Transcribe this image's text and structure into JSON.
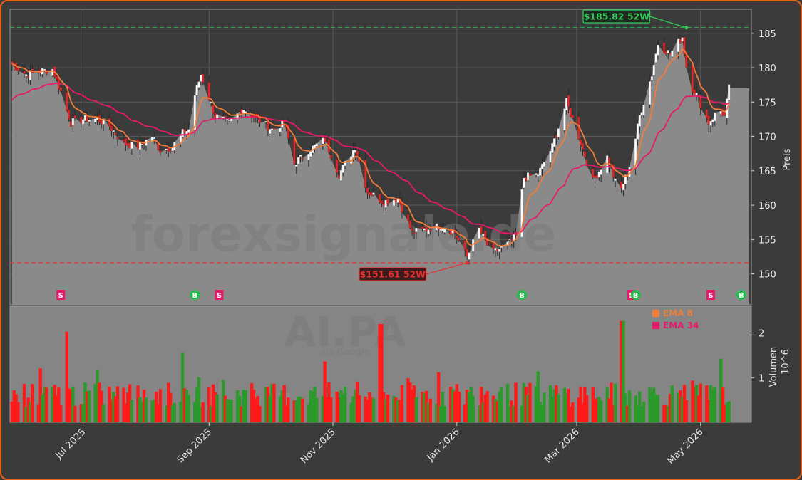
{
  "colors": {
    "background": "#3b3b3b",
    "panel": "#858585",
    "area": "#8a8a8a",
    "ema8": "#f07d3a",
    "ema34": "#e8196a",
    "up": "#2b9a2b",
    "down": "#ff1a1a",
    "high_line": "#2ecc55",
    "low_line": "#e83030",
    "border": "#e4621b"
  },
  "watermark": {
    "site": "forexsignale.de",
    "ticker": "AI.PA",
    "source": "via Google"
  },
  "chart_data": [
    {
      "type": "candlestick",
      "ylabel": "Preis",
      "ylim": [
        145.5,
        188.5
      ],
      "yticks": [
        150,
        155,
        160,
        165,
        170,
        175,
        180,
        185
      ],
      "x_range": [
        "2025-05-26",
        "2026-05-26"
      ],
      "xticks": [
        {
          "date": "2025-07-01",
          "label": "Jul 2025"
        },
        {
          "date": "2025-09-01",
          "label": "Sep 2025"
        },
        {
          "date": "2025-11-01",
          "label": "Nov 2025"
        },
        {
          "date": "2026-01-01",
          "label": "Jan 2026"
        },
        {
          "date": "2026-03-01",
          "label": "Mar 2026"
        },
        {
          "date": "2026-05-01",
          "label": "May 2026"
        }
      ],
      "close_path": [
        [
          "2025-05-27",
          180.5
        ],
        [
          "2025-06-03",
          179.0
        ],
        [
          "2025-06-10",
          179.5
        ],
        [
          "2025-06-16",
          179.8
        ],
        [
          "2025-06-20",
          176.5
        ],
        [
          "2025-06-25",
          172.0
        ],
        [
          "2025-07-01",
          172.5
        ],
        [
          "2025-07-08",
          172.5
        ],
        [
          "2025-07-14",
          171.5
        ],
        [
          "2025-07-21",
          169.0
        ],
        [
          "2025-07-28",
          168.5
        ],
        [
          "2025-08-04",
          170.0
        ],
        [
          "2025-08-08",
          168.0
        ],
        [
          "2025-08-14",
          168.5
        ],
        [
          "2025-08-19",
          170.5
        ],
        [
          "2025-08-22",
          171.0
        ],
        [
          "2025-08-25",
          176.0
        ],
        [
          "2025-08-28",
          179.0
        ],
        [
          "2025-09-04",
          173.0
        ],
        [
          "2025-09-11",
          172.0
        ],
        [
          "2025-09-18",
          174.0
        ],
        [
          "2025-09-25",
          172.5
        ],
        [
          "2025-10-02",
          171.0
        ],
        [
          "2025-10-08",
          172.0
        ],
        [
          "2025-10-13",
          166.0
        ],
        [
          "2025-10-20",
          168.0
        ],
        [
          "2025-10-28",
          169.5
        ],
        [
          "2025-11-04",
          164.5
        ],
        [
          "2025-11-12",
          168.5
        ],
        [
          "2025-11-18",
          162.0
        ],
        [
          "2025-11-26",
          160.5
        ],
        [
          "2025-12-03",
          161.0
        ],
        [
          "2025-12-10",
          156.0
        ],
        [
          "2025-12-17",
          156.5
        ],
        [
          "2025-12-24",
          157.0
        ],
        [
          "2025-12-31",
          156.0
        ],
        [
          "2026-01-06",
          152.5
        ],
        [
          "2026-01-12",
          156.5
        ],
        [
          "2026-01-18",
          153.0
        ],
        [
          "2026-01-25",
          154.0
        ],
        [
          "2026-01-30",
          155.5
        ],
        [
          "2026-02-03",
          164.0
        ],
        [
          "2026-02-10",
          164.5
        ],
        [
          "2026-02-17",
          168.5
        ],
        [
          "2026-02-24",
          175.0
        ],
        [
          "2026-03-02",
          170.0
        ],
        [
          "2026-03-09",
          163.5
        ],
        [
          "2026-03-16",
          167.0
        ],
        [
          "2026-03-22",
          161.5
        ],
        [
          "2026-03-28",
          166.5
        ],
        [
          "2026-04-01",
          173.0
        ],
        [
          "2026-04-07",
          179.0
        ],
        [
          "2026-04-10",
          183.5
        ],
        [
          "2026-04-16",
          182.0
        ],
        [
          "2026-04-22",
          184.5
        ],
        [
          "2026-04-25",
          178.0
        ],
        [
          "2026-04-29",
          176.0
        ],
        [
          "2026-05-05",
          172.0
        ],
        [
          "2026-05-10",
          174.0
        ],
        [
          "2026-05-13",
          173.0
        ],
        [
          "2026-05-16",
          179.0
        ]
      ],
      "last_close": 177.0,
      "high_52w": {
        "value": 185.82,
        "date": "2026-04-24",
        "label": "$185.82 52W"
      },
      "low_52w": {
        "value": 151.61,
        "date": "2026-01-06",
        "label": "$151.61 52W"
      },
      "signals": [
        {
          "date": "2025-06-20",
          "type": "S"
        },
        {
          "date": "2025-08-25",
          "type": "B"
        },
        {
          "date": "2025-09-06",
          "type": "S"
        },
        {
          "date": "2026-02-02",
          "type": "B"
        },
        {
          "date": "2026-03-28",
          "type": "S"
        },
        {
          "date": "2026-03-30",
          "type": "B"
        },
        {
          "date": "2026-05-06",
          "type": "S"
        },
        {
          "date": "2026-05-21",
          "type": "B"
        }
      ],
      "legend": [
        {
          "name": "EMA 8",
          "color": "#f07d3a"
        },
        {
          "name": "EMA 34",
          "color": "#e8196a"
        }
      ],
      "legend_position": "inside lower-right of price panel"
    },
    {
      "type": "bar",
      "ylabel": "Volumen",
      "yunit": "10^6",
      "ylim": [
        0,
        2.6
      ],
      "yticks": [
        1,
        2
      ],
      "description": "daily volume bars, green on up days, red on down days",
      "notable_peaks": [
        {
          "date": "2025-06-22",
          "value": 2.03
        },
        {
          "date": "2025-11-24",
          "value": 2.2
        },
        {
          "date": "2026-03-23",
          "value": 2.27
        }
      ]
    }
  ]
}
